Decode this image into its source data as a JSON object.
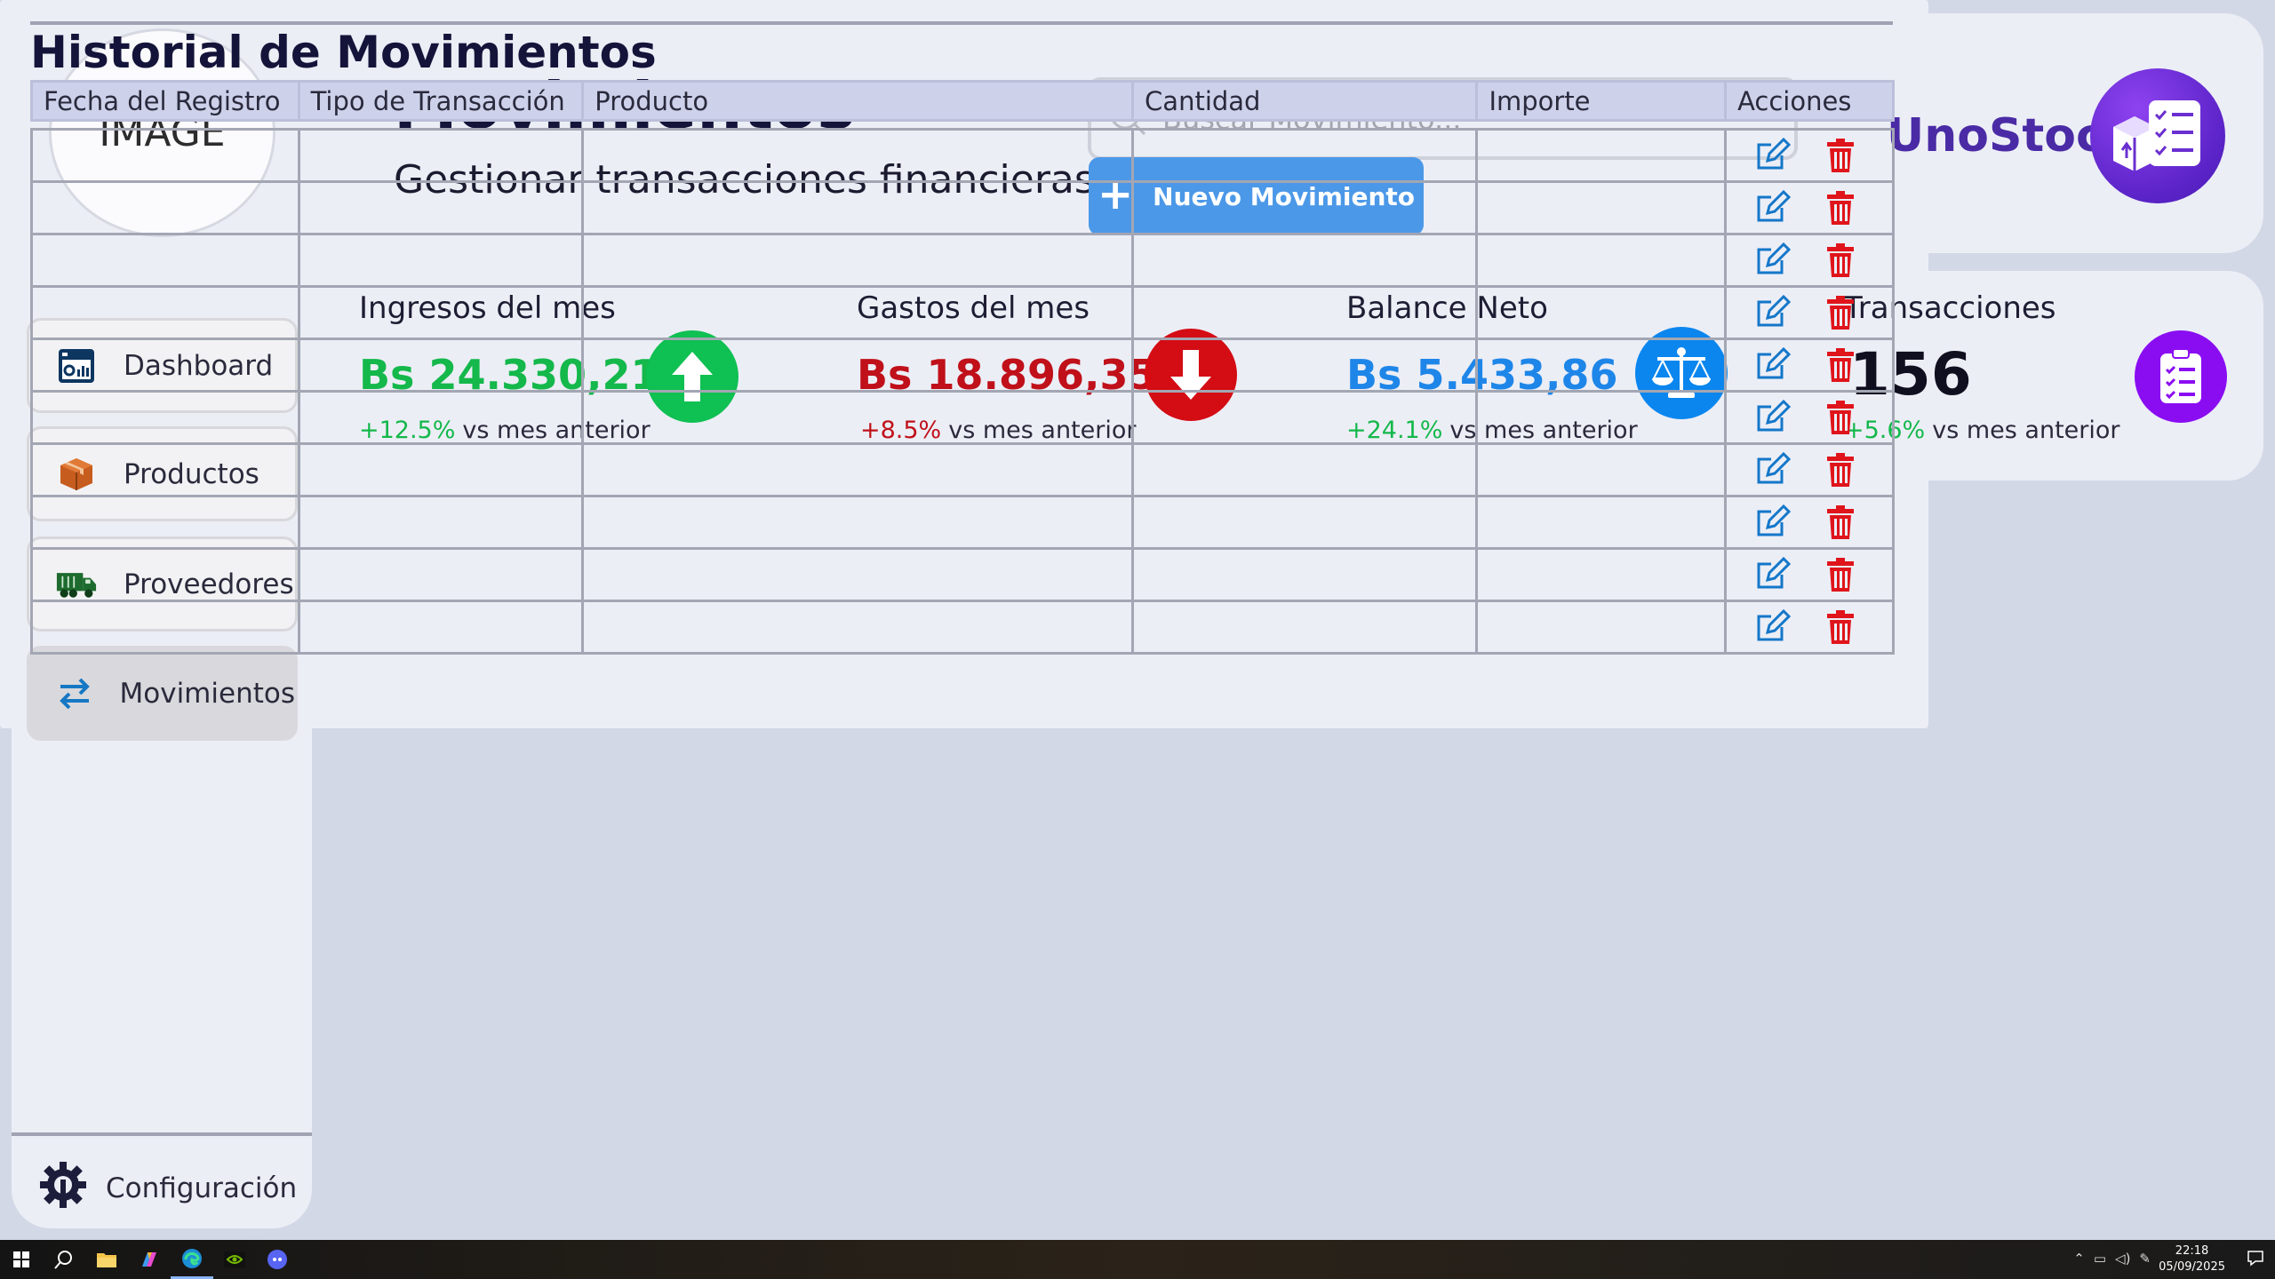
{
  "logo": {
    "placeholder": "IMAGE"
  },
  "header": {
    "title": "Movimientos",
    "subtitle": "Gestionar transacciones financieras",
    "search_placeholder": "Buscar Movimiento...",
    "new_button_label": "Nuevo Movimiento",
    "brand_name": "UnoStock"
  },
  "sidebar": {
    "items": [
      {
        "label": "Dashboard",
        "icon": "dashboard-icon",
        "active": false
      },
      {
        "label": "Productos",
        "icon": "box-icon",
        "active": false
      },
      {
        "label": "Proveedores",
        "icon": "truck-icon",
        "active": false
      },
      {
        "label": "Movimientos",
        "icon": "transfer-arrows-icon",
        "active": true
      }
    ],
    "config_label": "Configuración"
  },
  "stats": [
    {
      "title": "Ingresos del mes",
      "value": "Bs 24.330,21",
      "change": "+12.5%",
      "change_suffix": "vs mes anterior",
      "value_color": "#14b84b",
      "change_color": "#14b84b",
      "icon": "arrow-up-icon",
      "icon_bg": "#0fc052"
    },
    {
      "title": "Gastos del mes",
      "value": "Bs 18.896,35",
      "change": "+8.5%",
      "change_suffix": "vs mes anterior",
      "value_color": "#c0101a",
      "change_color": "#c0101a",
      "icon": "arrow-down-icon",
      "icon_bg": "#d40c14"
    },
    {
      "title": "Balance Neto",
      "value": "Bs 5.433,86",
      "change": "+24.1%",
      "change_suffix": "vs mes anterior",
      "value_color": "#1e86e8",
      "change_color": "#14b84b",
      "icon": "scale-icon",
      "icon_bg": "#0a86ee"
    },
    {
      "title": "Transacciones",
      "value": "156",
      "change": "+5.6%",
      "change_suffix": "vs mes anterior",
      "value_color": "#0f0f1f",
      "change_color": "#14b84b",
      "icon": "checklist-icon",
      "icon_bg": "#8a0df2"
    }
  ],
  "table": {
    "title": "Historial de Movimientos",
    "columns": [
      "Fecha del Registro",
      "Tipo de Transacción",
      "Producto",
      "Cantidad",
      "Importe",
      "Acciones"
    ],
    "row_count": 10,
    "action_icons": [
      "edit-icon",
      "delete-icon"
    ]
  },
  "taskbar": {
    "time": "22:18",
    "date": "05/09/2025"
  },
  "colors": {
    "background": "#d3d8e6",
    "panel": "#eceef6",
    "accent_button": "#4b98e8",
    "brand": "#4a2ba5",
    "edit_icon": "#1477c9",
    "delete_icon": "#e0141b"
  }
}
